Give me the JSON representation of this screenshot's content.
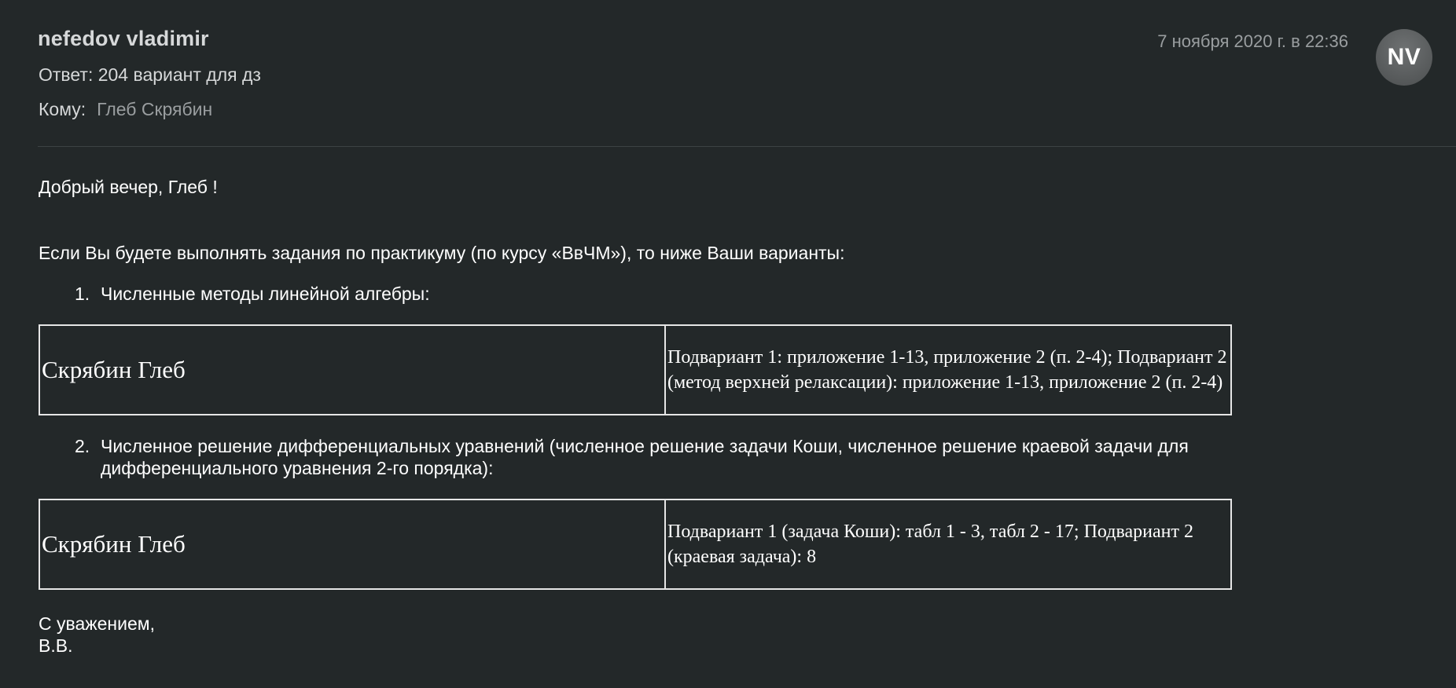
{
  "header": {
    "sender": "nefedov vladimir",
    "subject": "Ответ: 204 вариант для дз",
    "to_label": "Кому:",
    "to_name": "Глеб Скрябин",
    "datetime": "7 ноября 2020 г. в 22:36",
    "avatar_initials": "NV"
  },
  "message": {
    "greeting": "Добрый вечер, Глеб !",
    "intro": "Если Вы будете выполнять задания по практикуму (по курсу «ВвЧМ»), то ниже Ваши варианты:",
    "items": [
      {
        "number": "1.",
        "text": "Численные методы линейной алгебры:",
        "table": {
          "name": "Скрябин Глеб",
          "description": "Подвариант 1: приложение 1-13, приложение 2 (п. 2-4); Подвариант 2 (метод верхней релаксации): приложение 1-13, приложение 2 (п. 2-4)"
        }
      },
      {
        "number": "2.",
        "text": "Численное решение дифференциальных уравнений (численное решение задачи Коши, численное решение краевой задачи для дифференциального уравнения 2-го порядка):",
        "table": {
          "name": "Скрябин Глеб",
          "description": "Подвариант 1 (задача Коши): табл 1 - 3, табл 2 - 17; Подвариант 2 (краевая задача): 8"
        }
      }
    ],
    "closing": "С уважением,",
    "signature": "В.В."
  },
  "colors": {
    "background": "#232829",
    "header_text": "#d6d8d9",
    "muted_text": "#9a9ea0",
    "avatar": "#5c5f60",
    "table_border": "#e6e6e6"
  }
}
